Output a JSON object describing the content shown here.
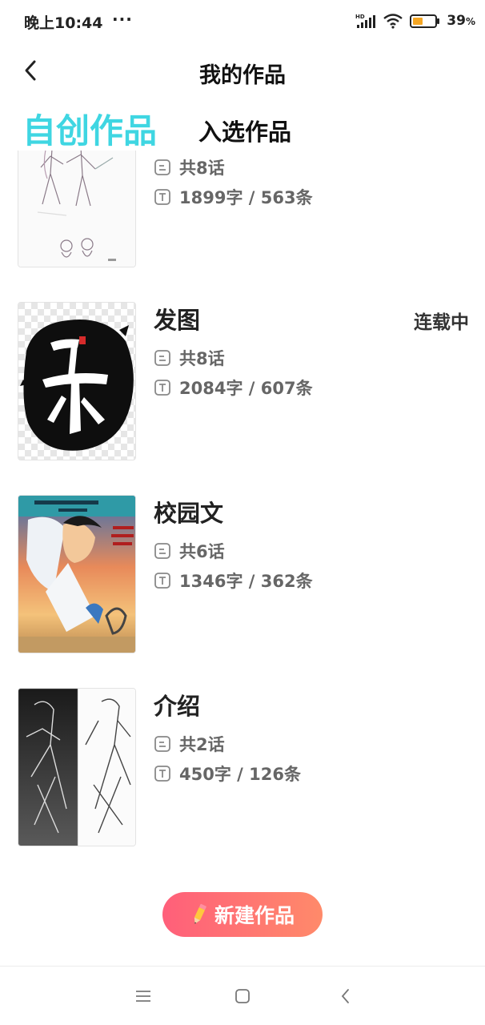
{
  "status_bar": {
    "time": "晚上10:44",
    "more": "···",
    "battery_percent": "39",
    "battery_unit": "%"
  },
  "header": {
    "title": "我的作品"
  },
  "tabs": {
    "active": "自创作品",
    "inactive": "入选作品"
  },
  "works": [
    {
      "title": "",
      "status": "",
      "chapters": "共8话",
      "stats": "1899字 / 563条"
    },
    {
      "title": "发图",
      "status": "连载中",
      "chapters": "共8话",
      "stats": "2084字 / 607条"
    },
    {
      "title": "校园文",
      "status": "",
      "chapters": "共6话",
      "stats": "1346字 / 362条"
    },
    {
      "title": "介绍",
      "status": "",
      "chapters": "共2话",
      "stats": "450字 / 126条"
    }
  ],
  "new_button": {
    "label": "新建作品"
  },
  "colors": {
    "accent_tab": "#3fd6e2",
    "button_gradient_start": "#ff5f7a",
    "button_gradient_end": "#ff8a6a",
    "battery_fill": "#f5a623"
  },
  "icons": {
    "chapters": "document-icon",
    "stats": "text-icon",
    "back": "chevron-left-icon",
    "pencil": "pencil-icon"
  }
}
